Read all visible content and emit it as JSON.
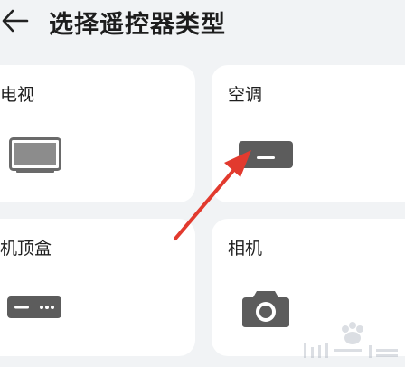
{
  "header": {
    "title": "选择遥控器类型"
  },
  "cards": {
    "tv": {
      "label": "电视"
    },
    "ac": {
      "label": "空调"
    },
    "stb": {
      "label": "机顶盒"
    },
    "camera": {
      "label": "相机"
    }
  },
  "icons": {
    "back": "back-arrow-icon",
    "tv": "tv-icon",
    "ac": "air-conditioner-icon",
    "stb": "set-top-box-icon",
    "camera": "camera-icon"
  },
  "colors": {
    "background": "#f1f3f5",
    "card": "#ffffff",
    "icon": "#555555",
    "annotation_arrow": "#e23a2e"
  }
}
